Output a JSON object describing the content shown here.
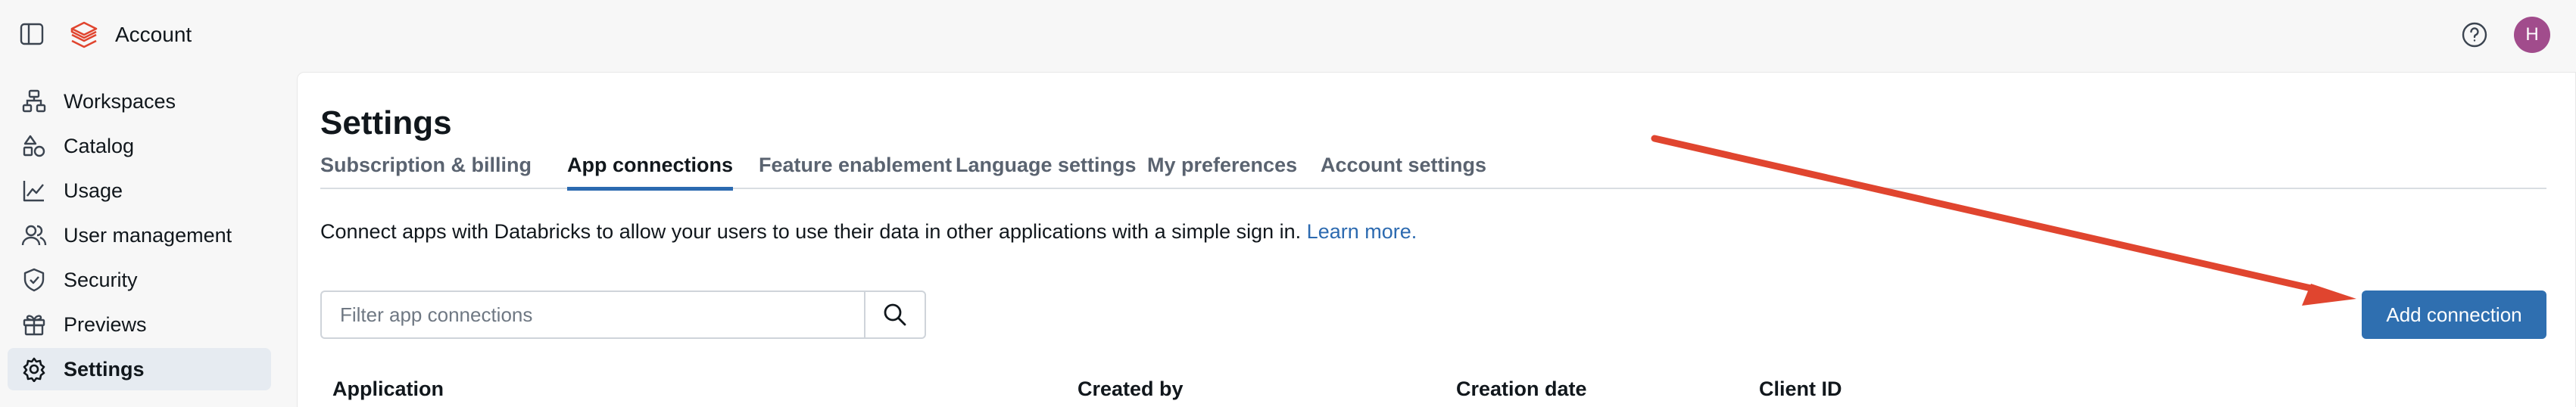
{
  "header": {
    "app_title": "Account",
    "avatar_initial": "H"
  },
  "sidebar": {
    "items": [
      {
        "label": "Workspaces",
        "icon": "workspaces-icon",
        "active": false
      },
      {
        "label": "Catalog",
        "icon": "catalog-icon",
        "active": false
      },
      {
        "label": "Usage",
        "icon": "usage-chart-icon",
        "active": false
      },
      {
        "label": "User management",
        "icon": "users-icon",
        "active": false
      },
      {
        "label": "Security",
        "icon": "shield-icon",
        "active": false
      },
      {
        "label": "Previews",
        "icon": "gift-icon",
        "active": false
      },
      {
        "label": "Settings",
        "icon": "gear-icon",
        "active": true
      }
    ]
  },
  "main": {
    "title": "Settings",
    "tabs": [
      {
        "label": "Subscription & billing",
        "active": false
      },
      {
        "label": "App connections",
        "active": true
      },
      {
        "label": "Feature enablement",
        "active": false
      },
      {
        "label": "Language settings",
        "active": false
      },
      {
        "label": "My preferences",
        "active": false
      },
      {
        "label": "Account settings",
        "active": false
      }
    ],
    "description": "Connect apps with Databricks to allow your users to use their data in other applications with a simple sign in.",
    "learn_more": "Learn more.",
    "filter": {
      "placeholder": "Filter app connections",
      "value": ""
    },
    "add_button": "Add connection",
    "columns": [
      "Application",
      "Created by",
      "Creation date",
      "Client ID"
    ]
  },
  "colors": {
    "accent": "#2f6fb0",
    "arrow": "#e0452f",
    "avatar": "#a14c8c",
    "logo": "#e0452f"
  }
}
